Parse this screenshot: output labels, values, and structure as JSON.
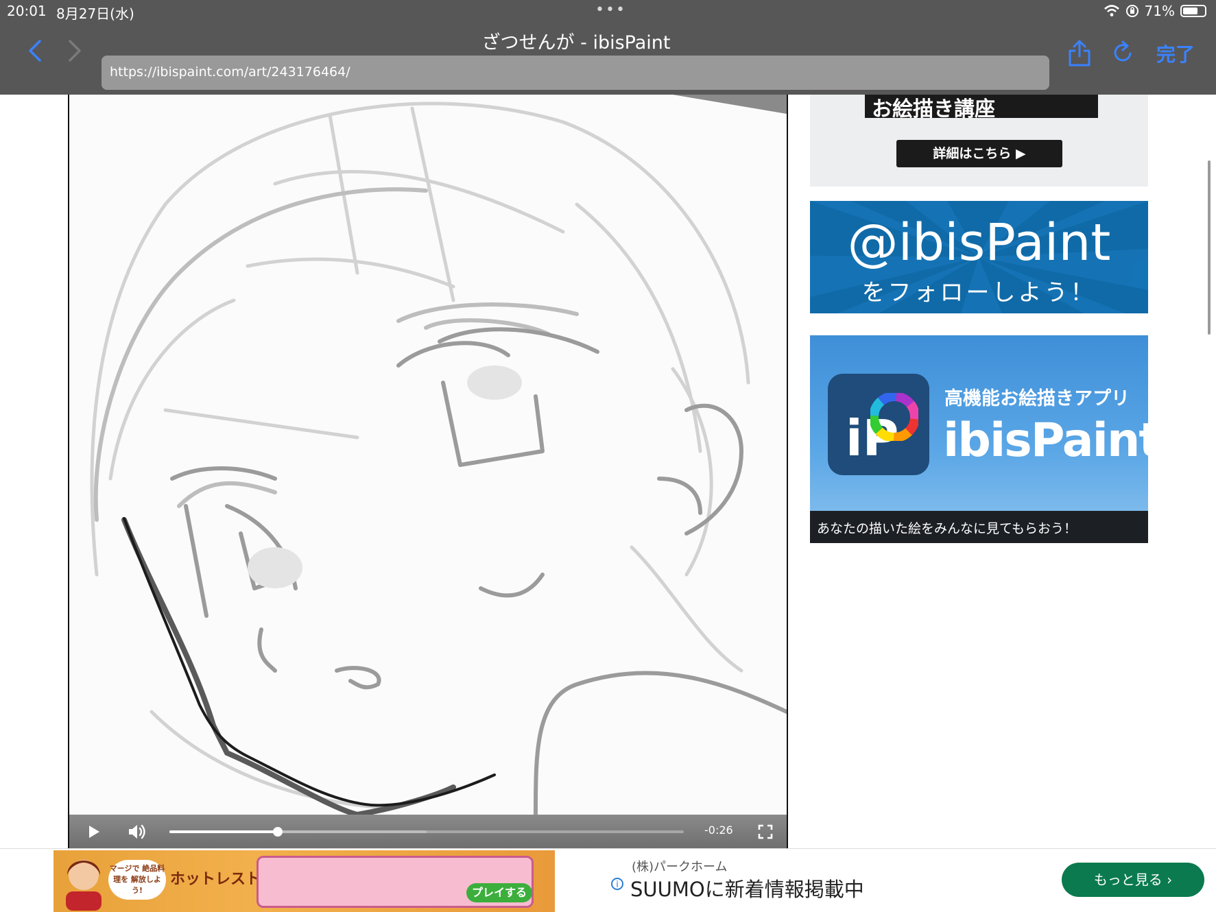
{
  "status_bar": {
    "time": "20:01",
    "date": "8月27日(水)",
    "battery": "71%",
    "battery_level": 0.71
  },
  "browser": {
    "title": "ざつせんが - ibisPaint",
    "url": "https://ibispaint.com/art/243176464/",
    "done_label": "完了"
  },
  "video": {
    "time_remaining": "-0:26",
    "progress": 0.21,
    "buffered": 0.5
  },
  "sidebar": {
    "ad1": {
      "band_text": "お絵描き講座",
      "button_label": "詳細はこちら ▶"
    },
    "ad2": {
      "handle": "@ibisPaint",
      "subtitle": "をフォローしよう！"
    },
    "ad3": {
      "tagline": "高機能お絵描きアプリ",
      "brand": "ibisPaint",
      "caption": "あなたの描いた絵をみんなに見てもらおう！"
    }
  },
  "bottom_ad": {
    "game": {
      "bubble": "マージで 絶品料理を 解放しよう!",
      "title": "ホットレストラン",
      "play_label": "プレイする"
    },
    "sponsor": "(株)パークホーム",
    "headline": "SUUMOに新着情報掲載中",
    "more_label": "もっと見る ›"
  },
  "colors": {
    "accent": "#3a82ff",
    "toolbar": "#575757",
    "twitter_blue": "#106aa8",
    "suumo_green": "#0b7a4f"
  }
}
